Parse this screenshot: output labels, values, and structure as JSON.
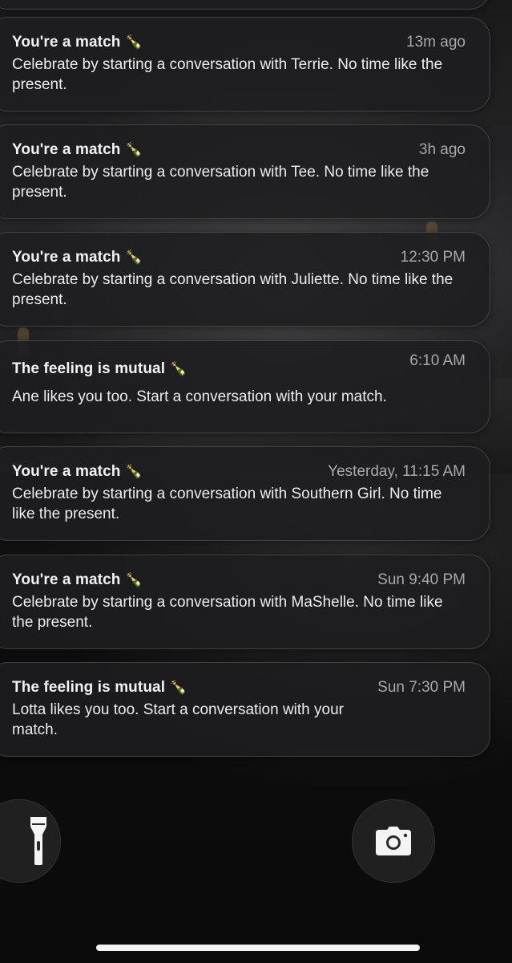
{
  "notifications": [
    {
      "title": "You're a match",
      "emoji": "🍾",
      "time": "13m ago",
      "body": "Celebrate by starting a conversation with Terrie. No time like the present."
    },
    {
      "title": "You're a match",
      "emoji": "🍾",
      "time": "3h ago",
      "body": "Celebrate by starting a conversation with Tee. No time like the present."
    },
    {
      "title": "You're a match",
      "emoji": "🍾",
      "time": "12:30 PM",
      "body": "Celebrate by starting a conversation with Juliette. No time like the present."
    },
    {
      "title": "The feeling is mutual",
      "emoji": "🍾",
      "time": "6:10 AM",
      "body": "Ane likes you too. Start a conversation with your match."
    },
    {
      "title": "You're a match",
      "emoji": "🍾",
      "time": "Yesterday, 11:15 AM",
      "body": "Celebrate by starting a conversation with Southern Girl. No time like the present."
    },
    {
      "title": "You're a match",
      "emoji": "🍾",
      "time": "Sun 9:40 PM",
      "body": "Celebrate by starting a conversation with MaShelle. No time like the present."
    },
    {
      "title": "The feeling is mutual",
      "emoji": "🍾",
      "time": "Sun 7:30 PM",
      "body": "Lotta likes you too. Start a conversation with your match."
    }
  ],
  "lockscreen_controls": {
    "left_icon": "flashlight-icon",
    "right_icon": "camera-icon"
  },
  "colors": {
    "card_background": "#1e1e20",
    "title_text": "#f2f2f2",
    "time_text": "#a8a8ab"
  }
}
